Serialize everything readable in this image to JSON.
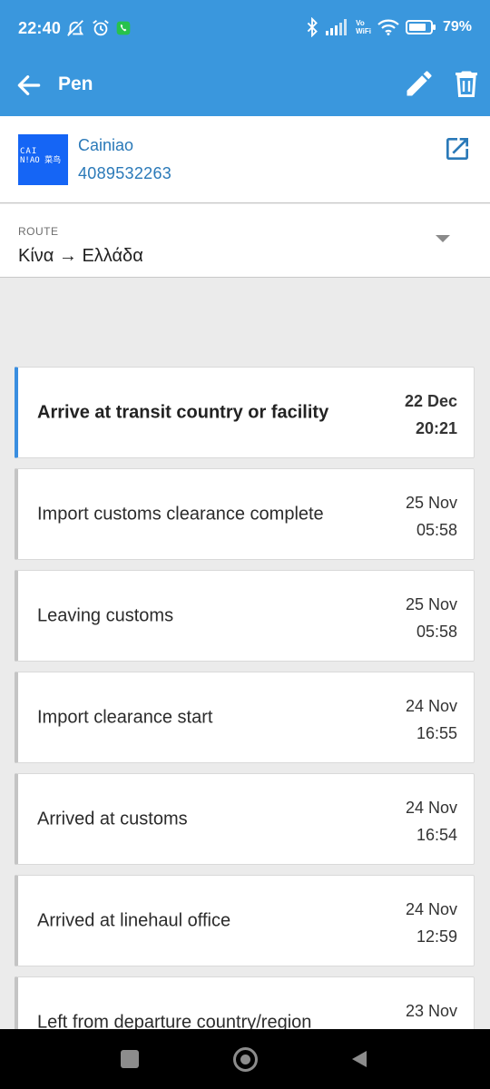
{
  "status_bar": {
    "time": "22:40",
    "battery": "79%",
    "network_label_top": "Vo",
    "network_label_bottom": "WiFi",
    "icons_left": [
      "mute-icon",
      "alarm-icon",
      "call-icon"
    ],
    "icons_right": [
      "bluetooth-icon",
      "signal-icon",
      "wifi-icon",
      "battery-icon"
    ]
  },
  "app_bar": {
    "title": "Pen",
    "icons": [
      "back-arrow-icon",
      "pencil-icon",
      "trash-icon"
    ]
  },
  "carrier": {
    "logo_line1": "CAI",
    "logo_line2": "N!AO 菜鸟",
    "name": "Cainiao",
    "tracking_number": "4089532263",
    "icon": "open-external-icon"
  },
  "route": {
    "label": "ROUTE",
    "value": "Κίνα → Ελλάδα",
    "icon": "dropdown-triangle-icon"
  },
  "events": [
    {
      "title": "Arrive at transit country or facility",
      "date": "22 Dec",
      "time": "20:21",
      "active": true
    },
    {
      "title": "Import customs clearance complete",
      "date": "25 Nov",
      "time": "05:58",
      "active": false
    },
    {
      "title": "Leaving customs",
      "date": "25 Nov",
      "time": "05:58",
      "active": false
    },
    {
      "title": "Import clearance start",
      "date": "24 Nov",
      "time": "16:55",
      "active": false
    },
    {
      "title": "Arrived at customs",
      "date": "24 Nov",
      "time": "16:54",
      "active": false
    },
    {
      "title": "Arrived at linehaul office",
      "date": "24 Nov",
      "time": "12:59",
      "active": false
    },
    {
      "title": "Left from departure country/region",
      "date": "23 Nov",
      "time": "",
      "active": false
    }
  ],
  "colors": {
    "primary": "#3a97dd",
    "link": "#2a79b8",
    "active_accent": "#3a8ee0",
    "carrier_brand": "#1565f5"
  },
  "nav_bar": {
    "icons": [
      "recents-icon",
      "home-icon",
      "back-triangle-icon"
    ]
  }
}
